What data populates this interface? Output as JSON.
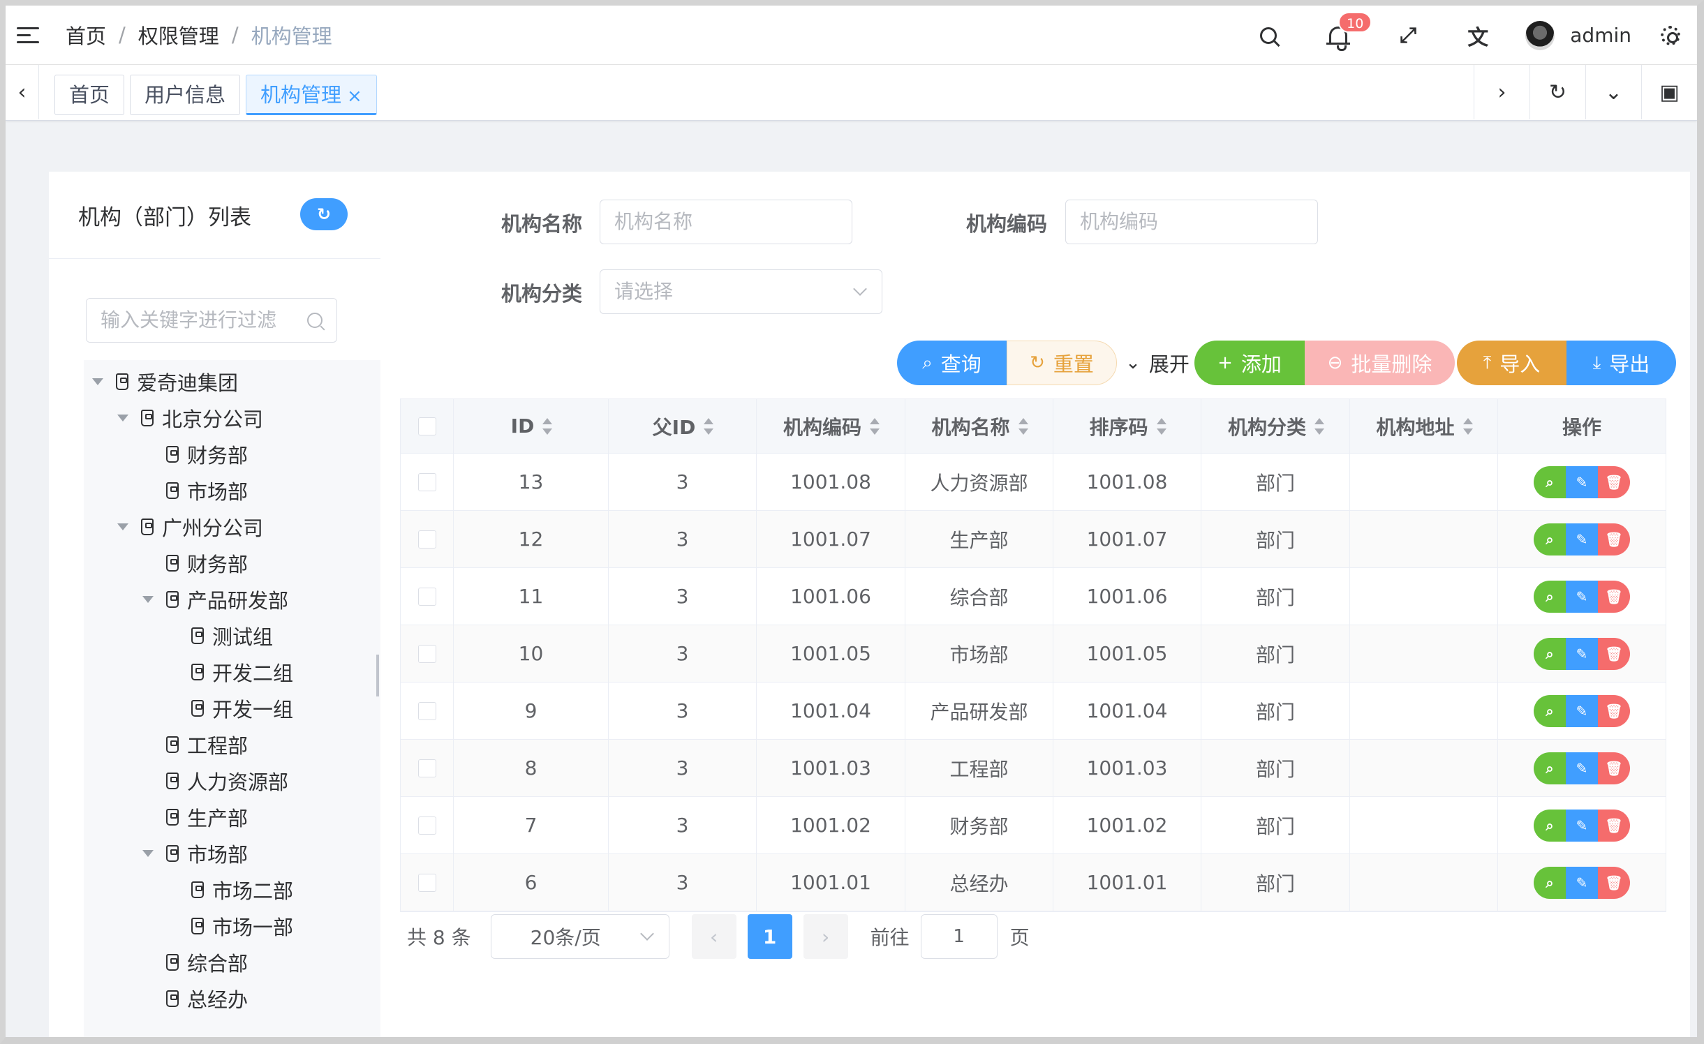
{
  "navbar": {
    "breadcrumb": [
      "首页",
      "权限管理",
      "机构管理"
    ],
    "separator": "/",
    "notification_count": "10",
    "username": "admin"
  },
  "tags": {
    "items": [
      "首页",
      "用户信息",
      "机构管理"
    ],
    "active_close": "×"
  },
  "left_panel": {
    "title": "机构（部门）列表",
    "refresh_icon": "↻",
    "filter_placeholder": "输入关键字进行过滤",
    "tree": [
      {
        "label": "爱奇迪集团",
        "level": 0,
        "expanded": true
      },
      {
        "label": "北京分公司",
        "level": 1,
        "expanded": true
      },
      {
        "label": "财务部",
        "level": 2,
        "expanded": false
      },
      {
        "label": "市场部",
        "level": 2,
        "expanded": false
      },
      {
        "label": "广州分公司",
        "level": 1,
        "expanded": true
      },
      {
        "label": "财务部",
        "level": 2,
        "expanded": false
      },
      {
        "label": "产品研发部",
        "level": 2,
        "expanded": true
      },
      {
        "label": "测试组",
        "level": 3,
        "expanded": false
      },
      {
        "label": "开发二组",
        "level": 3,
        "expanded": false
      },
      {
        "label": "开发一组",
        "level": 3,
        "expanded": false
      },
      {
        "label": "工程部",
        "level": 2,
        "expanded": false
      },
      {
        "label": "人力资源部",
        "level": 2,
        "expanded": false
      },
      {
        "label": "生产部",
        "level": 2,
        "expanded": false
      },
      {
        "label": "市场部",
        "level": 2,
        "expanded": true
      },
      {
        "label": "市场二部",
        "level": 3,
        "expanded": false
      },
      {
        "label": "市场一部",
        "level": 3,
        "expanded": false
      },
      {
        "label": "综合部",
        "level": 2,
        "expanded": false
      },
      {
        "label": "总经办",
        "level": 2,
        "expanded": false
      }
    ]
  },
  "search_form": {
    "name_label": "机构名称",
    "name_placeholder": "机构名称",
    "code_label": "机构编码",
    "code_placeholder": "机构编码",
    "category_label": "机构分类",
    "category_placeholder": "请选择"
  },
  "toolbar": {
    "query": "查询",
    "reset": "重置",
    "expand": "展开",
    "add": "添加",
    "batch_delete": "批量删除",
    "import": "导入",
    "export": "导出"
  },
  "table": {
    "columns": [
      "ID",
      "父ID",
      "机构编码",
      "机构名称",
      "排序码",
      "机构分类",
      "机构地址",
      "操作"
    ],
    "rows": [
      {
        "id": "13",
        "pid": "3",
        "code": "1001.08",
        "name": "人力资源部",
        "sort": "1001.08",
        "category": "部门",
        "address": ""
      },
      {
        "id": "12",
        "pid": "3",
        "code": "1001.07",
        "name": "生产部",
        "sort": "1001.07",
        "category": "部门",
        "address": ""
      },
      {
        "id": "11",
        "pid": "3",
        "code": "1001.06",
        "name": "综合部",
        "sort": "1001.06",
        "category": "部门",
        "address": ""
      },
      {
        "id": "10",
        "pid": "3",
        "code": "1001.05",
        "name": "市场部",
        "sort": "1001.05",
        "category": "部门",
        "address": ""
      },
      {
        "id": "9",
        "pid": "3",
        "code": "1001.04",
        "name": "产品研发部",
        "sort": "1001.04",
        "category": "部门",
        "address": ""
      },
      {
        "id": "8",
        "pid": "3",
        "code": "1001.03",
        "name": "工程部",
        "sort": "1001.03",
        "category": "部门",
        "address": ""
      },
      {
        "id": "7",
        "pid": "3",
        "code": "1001.02",
        "name": "财务部",
        "sort": "1001.02",
        "category": "部门",
        "address": ""
      },
      {
        "id": "6",
        "pid": "3",
        "code": "1001.01",
        "name": "总经办",
        "sort": "1001.01",
        "category": "部门",
        "address": ""
      }
    ]
  },
  "pagination": {
    "total": "共 8 条",
    "page_size": "20条/页",
    "current_page": "1",
    "goto_label": "前往",
    "goto_value": "1",
    "page_suffix": "页"
  },
  "colors": {
    "primary": "#409eff",
    "success": "#67c23a",
    "warning": "#e6a23c",
    "danger": "#f56c6c"
  }
}
